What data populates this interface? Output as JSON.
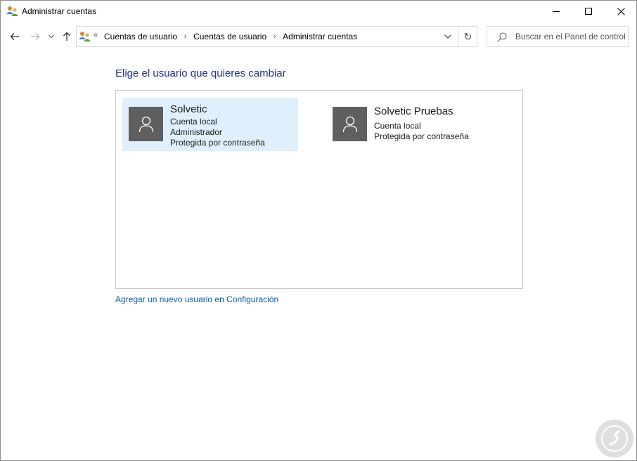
{
  "window": {
    "title": "Administrar cuentas",
    "icon": "user-accounts-icon"
  },
  "nav": {
    "back_icon": "arrow-left-icon",
    "forward_icon": "arrow-right-icon",
    "recent_icon": "chevron-down-icon",
    "up_icon": "arrow-up-icon"
  },
  "address": {
    "overflow": "«",
    "breadcrumbs": [
      "Cuentas de usuario",
      "Cuentas de usuario",
      "Administrar cuentas"
    ],
    "separator": "›",
    "refresh": "↻"
  },
  "search": {
    "placeholder": "Buscar en el Panel de control"
  },
  "main": {
    "heading": "Elige el usuario que quieres cambiar",
    "accounts": [
      {
        "name": "Solvetic",
        "lines": [
          "Cuenta local",
          "Administrador",
          "Protegida por contraseña"
        ],
        "selected": true
      },
      {
        "name": "Solvetic Pruebas",
        "lines": [
          "Cuenta local",
          "Protegida por contraseña"
        ],
        "selected": false
      }
    ],
    "add_user_link": "Agregar un nuevo usuario en Configuración"
  },
  "colors": {
    "heading": "#1e3287",
    "link": "#0b5aa8",
    "selected_bg": "#dff0fc",
    "avatar_bg": "#5f5f5f"
  }
}
